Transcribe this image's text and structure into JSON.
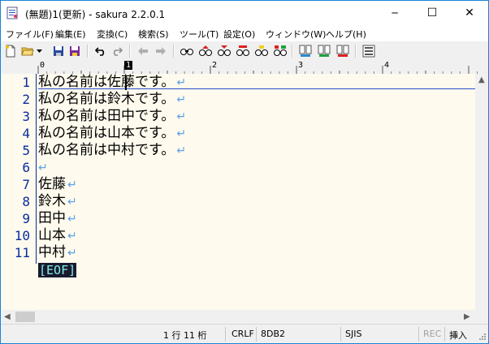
{
  "window": {
    "title": "(無題)1(更新) - sakura 2.2.0.1",
    "minimize_glyph": "─",
    "maximize_glyph": "☐",
    "close_glyph": "✕"
  },
  "menu": [
    "ファイル(F)",
    "編集(E)",
    "変換(C)",
    "検索(S)",
    "ツール(T)",
    "設定(O)",
    "ウィンドウ(W)",
    "ヘルプ(H)"
  ],
  "toolbar": {
    "icons": [
      "new-file-icon",
      "open-folder-icon",
      "dropdown-arrow-icon",
      "save-icon",
      "save-all-icon",
      "undo-icon",
      "redo-icon",
      "back-icon",
      "forward-icon",
      "search-icon",
      "search-prev-icon",
      "search-next-icon",
      "replace-icon",
      "mark-icon",
      "grep-icon",
      "compare-icon",
      "outline-icon",
      "bookmark-icon",
      "settings-icon"
    ]
  },
  "ruler": {
    "marks": [
      "0",
      "1",
      "2",
      "3",
      "4"
    ]
  },
  "editor": {
    "lines": [
      {
        "num": "1",
        "text": "私の名前は佐藤です。"
      },
      {
        "num": "2",
        "text": "私の名前は鈴木です。"
      },
      {
        "num": "3",
        "text": "私の名前は田中です。"
      },
      {
        "num": "4",
        "text": "私の名前は山本です。"
      },
      {
        "num": "5",
        "text": "私の名前は中村です。"
      },
      {
        "num": "6",
        "text": ""
      },
      {
        "num": "7",
        "text": "佐藤"
      },
      {
        "num": "8",
        "text": "鈴木"
      },
      {
        "num": "9",
        "text": "田中"
      },
      {
        "num": "10",
        "text": "山本"
      },
      {
        "num": "11",
        "text": "中村"
      }
    ],
    "crlf_mark": "↵",
    "eof_label": "[EOF]"
  },
  "status": {
    "position": "1 行  11 桁",
    "line_ending": "CRLF",
    "char_code": "8DB2",
    "encoding": "SJIS",
    "rec": "REC",
    "mode": "挿入"
  },
  "colors": {
    "editor_bg": "#fefaed",
    "line_number": "#0b2ba0",
    "crlf_mark": "#5fa0e8",
    "eof_bg": "#1a1a2e",
    "eof_fg": "#7df0e8"
  }
}
